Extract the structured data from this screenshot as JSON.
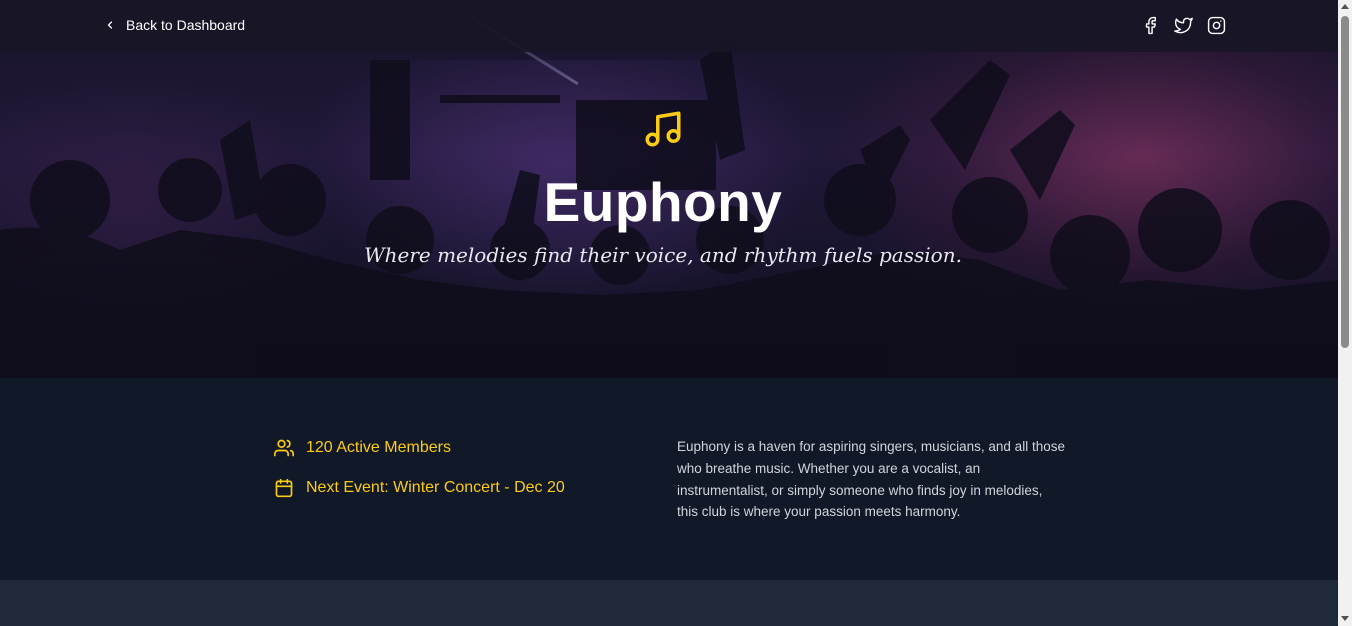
{
  "nav": {
    "back_label": "Back to Dashboard",
    "socials": [
      "facebook-icon",
      "twitter-icon",
      "instagram-icon"
    ]
  },
  "hero": {
    "icon": "music-note-icon",
    "title": "Euphony",
    "tagline": "Where melodies find their voice, and rhythm fuels passion."
  },
  "info": {
    "members": "120 Active Members",
    "next_event": "Next Event: Winter Concert - Dec 20",
    "description": "Euphony is a haven for aspiring singers, musicians, and all those who breathe music. Whether you are a vocalist, an instrumentalist, or simply someone who finds joy in melodies, this club is where your passion meets harmony."
  },
  "colors": {
    "accent": "#facc15",
    "background": "#111827",
    "footer_band": "#1f2937"
  }
}
